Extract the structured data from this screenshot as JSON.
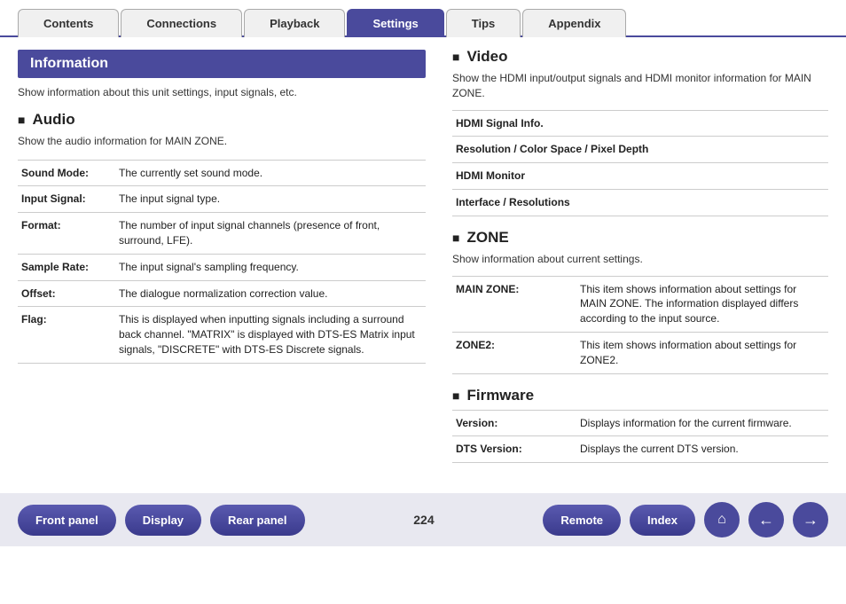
{
  "tabs": [
    {
      "id": "contents",
      "label": "Contents",
      "active": false
    },
    {
      "id": "connections",
      "label": "Connections",
      "active": false
    },
    {
      "id": "playback",
      "label": "Playback",
      "active": false
    },
    {
      "id": "settings",
      "label": "Settings",
      "active": true
    },
    {
      "id": "tips",
      "label": "Tips",
      "active": false
    },
    {
      "id": "appendix",
      "label": "Appendix",
      "active": false
    }
  ],
  "info_banner": "Information",
  "info_desc": "Show information about this unit settings, input signals, etc.",
  "audio": {
    "title": "Audio",
    "desc": "Show the audio information for MAIN ZONE.",
    "rows": [
      {
        "label": "Sound Mode:",
        "value": "The currently set sound mode."
      },
      {
        "label": "Input Signal:",
        "value": "The input signal type."
      },
      {
        "label": "Format:",
        "value": "The number of input signal channels (presence of front, surround, LFE)."
      },
      {
        "label": "Sample Rate:",
        "value": "The input signal's sampling frequency."
      },
      {
        "label": "Offset:",
        "value": "The dialogue normalization correction value."
      },
      {
        "label": "Flag:",
        "value": "This is displayed when inputting signals including a surround back channel. \"MATRIX\" is displayed with DTS-ES Matrix input signals, \"DISCRETE\" with DTS-ES Discrete signals."
      }
    ]
  },
  "video": {
    "title": "Video",
    "desc": "Show the HDMI input/output signals and HDMI monitor information for MAIN ZONE.",
    "rows": [
      {
        "label": "HDMI Signal Info.",
        "value": ""
      },
      {
        "label": "Resolution / Color Space / Pixel Depth",
        "value": ""
      },
      {
        "label": "HDMI Monitor",
        "value": ""
      },
      {
        "label": "Interface / Resolutions",
        "value": ""
      }
    ]
  },
  "zone": {
    "title": "ZONE",
    "desc": "Show information about current settings.",
    "rows": [
      {
        "label": "MAIN ZONE:",
        "value": "This item shows information about settings for MAIN ZONE. The information displayed differs according to the input source."
      },
      {
        "label": "ZONE2:",
        "value": "This item shows information about settings for ZONE2."
      }
    ]
  },
  "firmware": {
    "title": "Firmware",
    "rows": [
      {
        "label": "Version:",
        "value": "Displays information for the current firmware."
      },
      {
        "label": "DTS Version:",
        "value": "Displays the current DTS version."
      }
    ]
  },
  "page_num": "224",
  "bottom_nav": {
    "front_panel": "Front panel",
    "display": "Display",
    "rear_panel": "Rear panel",
    "remote": "Remote",
    "index": "Index"
  }
}
